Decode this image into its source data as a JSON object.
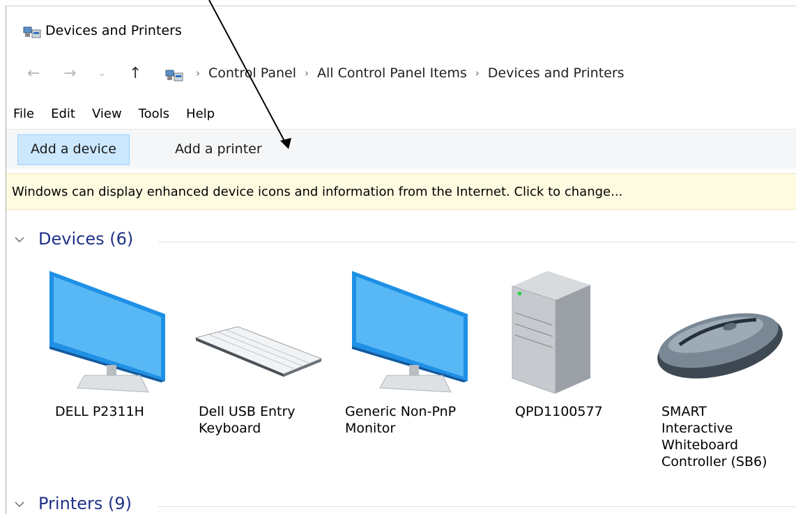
{
  "window": {
    "title": "Devices and Printers"
  },
  "address": {
    "crumbs": [
      "Control Panel",
      "All Control Panel Items",
      "Devices and Printers"
    ]
  },
  "menu": [
    "File",
    "Edit",
    "View",
    "Tools",
    "Help"
  ],
  "toolbar": {
    "add_device": "Add a device",
    "add_printer": "Add a printer"
  },
  "infobar": {
    "text": "Windows can display enhanced device icons and information from the Internet. Click to change..."
  },
  "groups": {
    "devices": {
      "title": "Devices (6)"
    },
    "printers": {
      "title": "Printers (9)"
    }
  },
  "devices": [
    {
      "label": "DELL P2311H",
      "icon": "monitor-icon"
    },
    {
      "label": "Dell USB Entry Keyboard",
      "icon": "keyboard-icon"
    },
    {
      "label": "Generic Non-PnP Monitor",
      "icon": "monitor-icon"
    },
    {
      "label": "QPD1100577",
      "icon": "computer-tower-icon"
    },
    {
      "label": "SMART Interactive Whiteboard Controller (SB6)",
      "icon": "mouse-icon"
    }
  ],
  "colors": {
    "accent": "#1e3287",
    "selected_bg": "#cce8ff",
    "infobar_bg": "#fffbe1"
  }
}
